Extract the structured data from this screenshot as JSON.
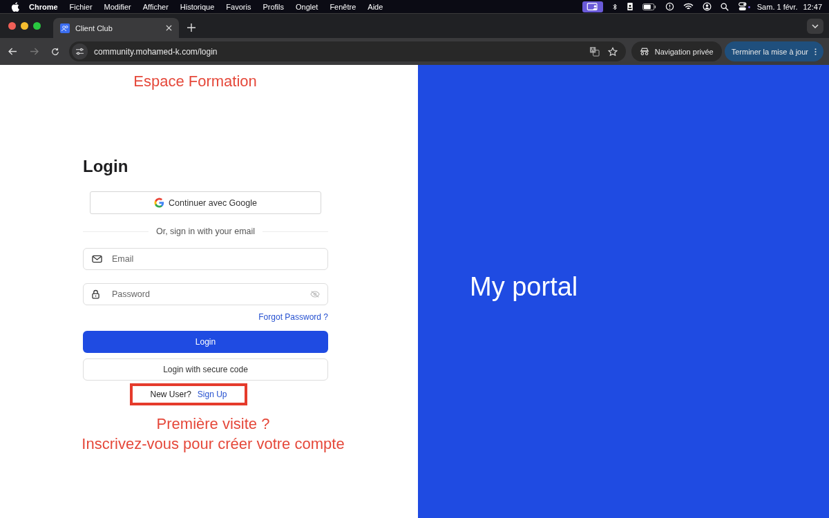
{
  "menubar": {
    "app": "Chrome",
    "items": [
      "Fichier",
      "Modifier",
      "Afficher",
      "Historique",
      "Favoris",
      "Profils",
      "Onglet",
      "Fenêtre",
      "Aide"
    ],
    "date": "Sam. 1 févr.",
    "time": "12:47"
  },
  "tabs": [
    {
      "title": "Client Club",
      "selected": true
    }
  ],
  "toolbar": {
    "address": "community.mohamed-k.com/login",
    "incognito": "Navigation privée",
    "update": "Terminer la mise à jour"
  },
  "annotation_top": "Espace Formation",
  "login": {
    "title": "Login",
    "google_button": "Continuer avec Google",
    "divider": "Or, sign in with your email",
    "email_placeholder": "Email",
    "password_placeholder": "Password",
    "forgot": "Forgot Password ?",
    "login_button": "Login",
    "secure_button": "Login with secure code",
    "new_user": "New User?",
    "sign_up": "Sign Up"
  },
  "annotation_bottom": [
    "Première visite ?",
    "Inscrivez-vous pour créer votre compte"
  ],
  "hero": {
    "title": "My portal"
  }
}
